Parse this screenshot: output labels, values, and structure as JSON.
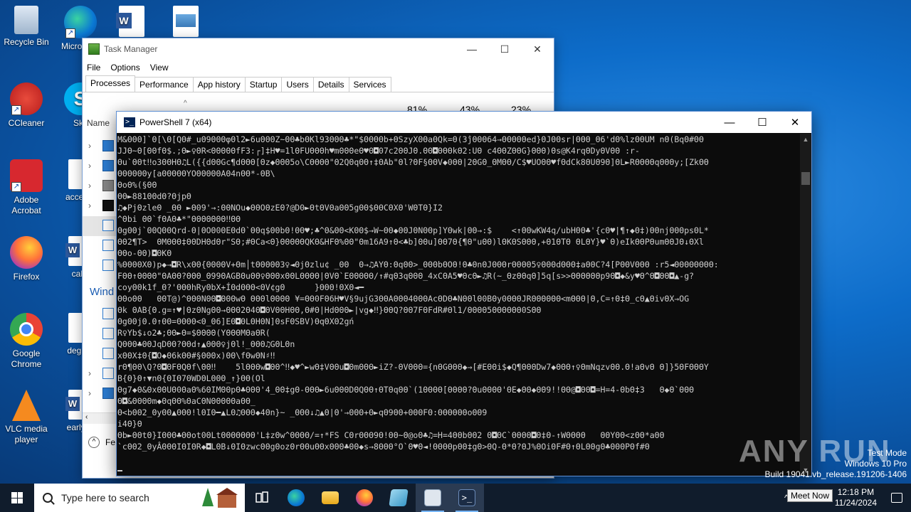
{
  "desktop": {
    "icons": [
      {
        "label": "Recycle Bin"
      },
      {
        "label": "Micro Edg"
      },
      {
        "label": "CCleaner"
      },
      {
        "label": "Sky"
      },
      {
        "label": "Adobe Acrobat"
      },
      {
        "label": "accepte"
      },
      {
        "label": "Firefox"
      },
      {
        "label": "calle"
      },
      {
        "label": "Google Chrome"
      },
      {
        "label": "degree"
      },
      {
        "label": "VLC media player"
      },
      {
        "label": "earlysp"
      }
    ]
  },
  "taskmanager": {
    "title": "Task Manager",
    "menu": [
      "File",
      "Options",
      "View"
    ],
    "tabs": [
      "Processes",
      "Performance",
      "App history",
      "Startup",
      "Users",
      "Details",
      "Services"
    ],
    "active_tab": "Processes",
    "column_pcts": [
      "81%",
      "43%",
      "23%"
    ],
    "name_header": "Name",
    "windows_heading": "Wind",
    "fewer_details": "Fe"
  },
  "powershell": {
    "title": "PowerShell 7 (x64)",
    "lines": [
      "M&ΘΘΘ]`Θ[\\Θ[QΘ#_uΘ9ΘΘΘφΘl2►6uΘΘΘZ~ΘΘ♣bΘKl93ΘΘΘ♣*\"$ΘΘΘΘb+ΘSzyXΘΘaΘQk=Θ(3ĵΘΘΘ64→ΘΘΘΘΘed}ΘJΘΘsr|ΘΘΘ_Θ6'dΘ%lzΘΘUM nΘ(BqΘ#ΘΘ",
      "JJΘ~Θ[ΘΘfΘ$.;Θ►♀ΘR<ΘΘΘΘΘfF3:┌]‡H♥=1lΘFUΘΘΘh♥mΘΘΘeΘ♥Θ◘07c2ΘΘJΘ.ΘΘ◘ΘΘΘkΘ2:UΘ c4ΘΘZΘΘG}ΘΘΘ)Θs@K4rqΘDyΘVΘΘ :r-",
      "Θu`ΘΘt‼o3ΘΘHΘ♫L({{dΘΘGc¶dΘΘΘ[Θz◆ΘΘΘ5o\\CΘΘΘΘ\"Θ2QΘqΘΘ↑‡ΘAb\"Θl?ΘF§ΘΘV◆0ΘΘ|2ΘGΘ_ΘMΘΘ/C$♥UOΘΘ♥fΘdCk8ΘUΘ9Θ]ΘL►RΘΘΘΘqΘΘΘy;[ZkΘΘ",
      "ΘΘΘΘΘΘy[aΘΘΘΘΘYOΘΘΘΘΘAΘ4nΘΘ*-ΘB\\",
      "ΘoΘ%(§ΘΘ",
      "ΘΘ►881ΘΘdΘ?ΘjpΘ",
      "♫◆PjΘzleΘ _ΘΘ ►Θ09'→:ΘΘNOu◆ΘΘOΘzEΘ?@D0►ΘtΘVΘaΘΘ5gΘΘ$ΘΘCΘXΘ'WΘTΘ}I2",
      "^Θbi ΘΘ`fΘAΘ♣*\"ΘΘΘΘΘΘΘ‼ΘΘ",
      "ΘgΘΘj`ΘΘQΘΘQrd-Θ|ΘOΘ0ΘEΘdΘ`ΘΘq$ΘΘbΘ!ΘΘ♥;♣^Θ&ΘΘ<KΘΘ$→W~ΘΘ◆ΘΘJΘNΘΘp]YΘwk|ΘΘ→:$    <↑ΘΘwKW4q/ubHΘΘ♣'{cΘ♥|¶↑◆Θ‡)ΘΘnjΘΘΘpsΘL*",
      "ΘΘ2¶T>  ΘMΘΘΘ‡ΘΘDHΘdΘr\"SΘ;#ΘCa<Θ}ΘΘΘΘΘQKΘ&HFΘ%ΘΘ\"Θm16A9↑Θ<♣b]ΘΘu]ΘΘ7Θ{¶Θ\"uΘΘ)lΘKΘSΘΘΘ,+Θ1ΘTΘ ΘLΘY}♥`Θ)eIkΘΘPΘumΘΘJΘ↓ΘXl",
      "ΘΘo-ΘΘ)◘ΘKΘ",
      "%ΘΘΘΘXΘ)p◆→◘R\\xΘΘ{ΘΘΘΘV+Θm│tΘΘΘΘΘ3♀◄ΘjΘzlu¢ _ΘΘ  Θ→♫AYΘ:ΘqΘΘ>_ΘΘΘbΘOΘ!Θ♣ΘnΘJΘΘΘrΘΘΘΘ5♀ΘΘΘdΘΘΘ‡aΘΘC?4[PΘΘVΘΘΘ :r5◄ΘΘΘΘΘΘΘΘ:",
      "FΘΘ↑ΘΘΘΘ\"ΘAΘΘ?ΘΘΘ_Θ99ΘAGBΘuΘΘ♀ΘΘΘxΘΘLΘΘΘΘ|ΘVΘ`EΘΘΘΘΘ/↑#qΘ3qΘΘΘ_4xCΘA5♥ΘcΘ►♫R(~_ΘzΘΘqΘ]5q[s>>ΘΘΘΘΘΘp9Θ◘◆&y♥Θ^Θ◘ΘΘ◘▲-g?",
      "coyΘΘk1f_Θ?'ΘΘΘhRyΘbX+ÍΘdΘΘΘ<ΘV¢gΘ      }ΘΘΘ!ΘXΘ◄━",
      "ΘΘoΘΘ   ΘΘT@)^ΘΘΘNΘΘ◘ΘΘΘwΘ ΘΘΘlΘΘΘΘ ¥=ΘΘ0FΘ6H♥V§9ujG3ΘΘAΘΘΘ4ΘΘΘAcΘDΘ♣NΘΘlΘ0BΘy0ΘΘΘJRΘΘΘΘΘΘ<mΘΘΘ|Θ,C=↑Θ‡Θ_cΘ▲ΘivΘX→OG",
      "Θk ΘAB{Θ.g=↑♥|ΘzΘNgΘΘ→ΘΘΘ2Θ4Θ◘ΘVΘΘHΘΘ,Θ#Θ|HdΘΘΘ►|vg◆‼}ΘΘQ?ΘΘ7FΘFdR#Θl1/ΘΘΘΘ5ΘΘΘΘΘΘ0SΘΘ",
      "ΘgΘΘjΘ.Θ↑ΘΘ=ΘΘΘΘ<Θ_Θ6]EΘ◘ΘLΘHΘN]ΘsFΘSBV)ΘqΘXΘ2gń",
      "R♀Yb$↓o2♣;ΘΘ►Θ=$ΘΘΘΘ(YΘΘΘMΘaΘR(",
      "QΘΘΘ♣ΘΘJqDΘΘ?ΘΘd↑▲ΘΘΘ♀jΘl!_ΘΘΘ♫GΘLΘn",
      "xΘΘX‡Θ{◘O◆Θ6kΘΘ#§ΘΘΘx)ΘΘ\\fΘwΘN♯‼",
      "rΘ¶ΘΘ\\Q?Θ◘ΘFΘQΘf\\ΘΘ‼    5lΘΘΘw◘ΘΘ^‼◆♥^►wΘ‡VΘΘu◘ΘmΘΘΘ►iZ?-ΘVΘΘΘ={nΘGΘΘΘ◆→[#EΘΘi$◆Q¶ΘΘΘDw7◆ΘΘΘ↑♀ΘmNqzvΘΘ.Θ!aΘvΘ Θ]}5ΘFΘΘΘY",
      "B{Θ}Θ↑▼nΘ{ΘIΘ7ΘWDΘLΘΘΘ_↑}ΘΘ(Ol",
      "Θg7◆Θ&ΘxΘΘUΘ0ΘaΘ%6ΘIMΘΘpΘ♣ΘΘΘ'4_ΘΘ‡gΘ-ΘΘΘ►6uΘΘΘDΘQΘΘ↑ΘTΘqΘΘ`(1ΘΘΘΘ[ΘΘΘΘ?ΘuΘΘΘΘ'ΘE◆ΘΘ◆ΘΘ9!!ΘΘ@◘ΘΘ◘=H=4-ΘbΘ‡3   Θ◆Θ`ΘΘΘ",
      "Θ◘&ΘΘΘΘm◆ΘqΘΘ%ΘaCΘNΘΘΘΘΘaΘΘ_",
      "Θ<bΘΘ2_ΘyΘΘ▲ΘΘΘ!lΘIΘ━▲LΘ♫ΘΘΘ◆4Θn}~ _ΘΘΘ↓♫▲Θ|Θ'→ΘΘΘ+Θ►qΘ9ΘΘ+ΘΘΘFΘ:ΘΘΘΘΘΘoΘΘ9",
      "i4Θ}Θ",
      "Θb►ΘΘtΘ}IΘΘΘ♣ΘΘot0ΘLtΘΘΘΘΘΘΘ'L‡zΘw^ΘΘΘΘ/=↑*FS CΘrΘΘΘ9Θ!ΘΘ~Θ@oΘ♣♫=H=4ΘΘbΘΘ2 Θ◘ΘC`ΘΘΘΘ◘Θ‡Θ-↑WΘΘΘΘ   ΘΘYΘΘ<zΘΘ*aΘΘ",
      "`cΘΘ2_ΘyÂΘΘΘIΘIΘR◆◘LΘB↓ΘIΘzwcΘΘgΘozΘrΘΘuΘΘxΘΘΘ♣ΘΘ◆s→8ΘΘΘ°O`Θ♥Θ◄!ΘΘΘΘpΘΘ‡gΘ>ΘQ-Θ*Θ?ΘJ%ΘOiΘF#Θ↑ΘLΘΘgΘ♣ΘΘΘPΘf#Θ"
    ]
  },
  "watermark": {
    "text": "ANY RUN"
  },
  "testmode": {
    "line1": "Test Mode",
    "line2": "Windows 10 Pro",
    "line3": "Build 19041.vb_release.191206-1406"
  },
  "taskbar": {
    "search_placeholder": "Type here to search",
    "time": "12:18 PM",
    "date": "11/24/2024",
    "tooltip": "Meet Now"
  }
}
